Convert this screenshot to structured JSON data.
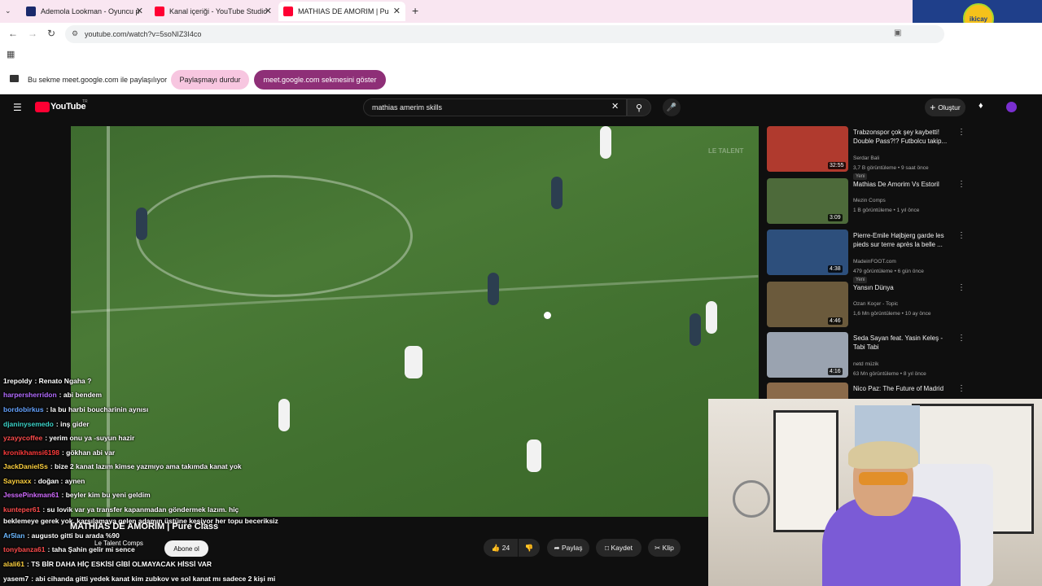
{
  "browser": {
    "tabs": [
      {
        "label": "Ademola Lookman - Oyuncu p",
        "icon": "sofascore-icon",
        "color": "#1a2a6c"
      },
      {
        "label": "Kanal içeriği - YouTube Studio",
        "icon": "youtube-studio-icon",
        "color": "#ff0033"
      },
      {
        "label": "MATHIAS DE AMORIM | Pu",
        "icon": "youtube-icon",
        "color": "#ff0033"
      }
    ],
    "url": "youtube.com/watch?v=5soNIZ3I4co",
    "share_text": "Bu sekme meet.google.com ile paylaşılıyor",
    "stop_share": "Paylaşmayı durdur",
    "show_tab": "meet.google.com sekmesini göster"
  },
  "youtube": {
    "logo": "YouTube",
    "country": "TR",
    "search_value": "mathias amerim skills",
    "create_label": "Oluştur",
    "video_title": "MATHIAS DE AMORIM | Pure Class",
    "channel": "Le Talent Comps",
    "subscribe": "Abone ol",
    "like_count": "24",
    "share": "Paylaş",
    "save": "Kaydet",
    "clip": "Klip",
    "watermark": "LE TALENT"
  },
  "sidebar": [
    {
      "title": "Trabzonspor çok şey kaybetti! Double Pass?!? Futbolcu takip...",
      "channel": "Serdar Bali",
      "meta": "3,7 B görüntüleme • 9 saat önce",
      "badge": "Yeni",
      "duration": "32:55",
      "color": "#b03a2e"
    },
    {
      "title": "Mathias De Amorim Vs Estoril",
      "channel": "Mezin Comps",
      "meta": "1 B görüntüleme • 1 yıl önce",
      "badge": "",
      "duration": "3:09",
      "color": "#4d6a3a"
    },
    {
      "title": "Pierre-Emile Højbjerg garde les pieds sur terre après la belle ...",
      "channel": "MadeinFOOT.com",
      "meta": "479 görüntüleme • 6 gün önce",
      "badge": "Yeni",
      "duration": "4:38",
      "color": "#2d4f7c"
    },
    {
      "title": "Yansın Dünya",
      "channel": "Ozan Koçer - Topic",
      "meta": "1,6 Mn görüntüleme • 10 ay önce",
      "badge": "",
      "duration": "4:46",
      "color": "#6b5a3c"
    },
    {
      "title": "Seda Sayan feat. Yasin Keleş - Tabi Tabi",
      "channel": "netd müzik",
      "meta": "63 Mn görüntüleme • 8 yıl önce",
      "badge": "",
      "duration": "4:16",
      "color": "#9aa3b0"
    },
    {
      "title": "Nico Paz: The Future of Madrid",
      "channel": "",
      "meta": "",
      "badge": "",
      "duration": "",
      "color": "#8a6a4a"
    }
  ],
  "chat": [
    {
      "user": "1repoldy",
      "msg": ": Renato Ngaha ?",
      "color": "#ffffff"
    },
    {
      "user": "harpersherridon",
      "msg": ": abi bendem",
      "color": "#b36bff"
    },
    {
      "user": "bordobirkus",
      "msg": ": la bu harbi boucharinin aynısı",
      "color": "#66a3ff"
    },
    {
      "user": "djaninysemedo",
      "msg": ": inş gider",
      "color": "#3cd3c8"
    },
    {
      "user": "yzayycoffee",
      "msg": ": yerim onu ya -suyun hazir",
      "color": "#ff4d4d"
    },
    {
      "user": "kronikhamsi6198",
      "msg": ": gökhan abi var",
      "color": "#ff3b3b"
    },
    {
      "user": "JackDanielSs",
      "msg": ": bize 2 kanat lazım kimse yazmıyo ama takımda kanat yok",
      "color": "#ffd23f"
    },
    {
      "user": "Saynaxx",
      "msg": ": doğan : aynen",
      "color": "#ffd23f"
    },
    {
      "user": "JessePinkman61",
      "msg": ": beyler kim bu yeni geldim",
      "color": "#d16bff"
    },
    {
      "user": "kunteper61",
      "msg": ": su lovik var ya transfer kapanmadan göndermek lazım. hiç",
      "color": "#ff4d4d"
    },
    {
      "user": "",
      "msg": "beklemeye gerek yok. karşılamaya gelen adamın üstüne kesiyor her topu beceriksiz",
      "color": "#ffffff"
    },
    {
      "user": "Ar5lan",
      "msg": ": augusto gitti bu arada %90",
      "color": "#6bb8ff"
    },
    {
      "user": "tonybanza61",
      "msg": ": taha Şahin gelir mi sence",
      "color": "#ff4d4d"
    },
    {
      "user": "alali61",
      "msg": ": TS BİR DAHA HİÇ ESKİSİ GİBİ OLMAYACAK HİSSİ VAR",
      "color": "#ffd23f"
    },
    {
      "user": "yasem7",
      "msg": ": abi cihanda gitti yedek kanat kim zubkov ve sol kanat mı sadece 2 kişi mi",
      "color": "#ffffff"
    }
  ],
  "overlay_logo": "ikicay"
}
